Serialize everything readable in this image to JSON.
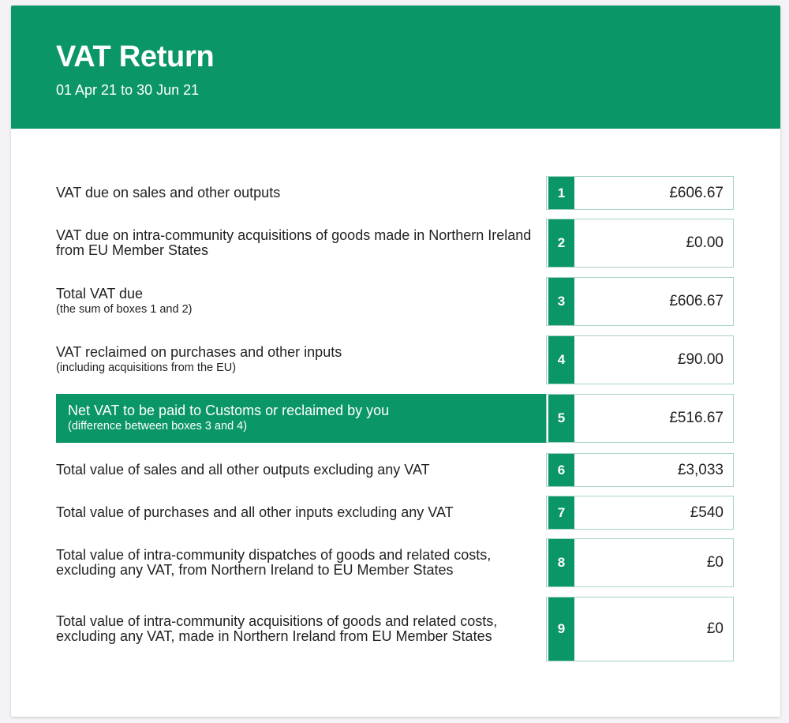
{
  "header": {
    "title": "VAT Return",
    "period": "01 Apr 21 to 30 Jun 21"
  },
  "colors": {
    "brand_green": "#0b9668",
    "box_border": "#a7d3c1"
  },
  "rows": [
    {
      "box": "1",
      "label": "VAT due on sales and other outputs",
      "sublabel": "",
      "value": "£606.67",
      "highlight": false
    },
    {
      "box": "2",
      "label": "VAT due on intra-community acquisitions of goods made in Northern Ireland from EU Member States",
      "sublabel": "",
      "value": "£0.00",
      "highlight": false
    },
    {
      "box": "3",
      "label": "Total VAT due",
      "sublabel": "(the sum of boxes 1 and 2)",
      "value": "£606.67",
      "highlight": false
    },
    {
      "box": "4",
      "label": "VAT reclaimed on purchases and other inputs",
      "sublabel": "(including acquisitions from the EU)",
      "value": "£90.00",
      "highlight": false
    },
    {
      "box": "5",
      "label": "Net VAT to be paid to Customs or reclaimed by you",
      "sublabel": "(difference between boxes 3 and 4)",
      "value": "£516.67",
      "highlight": true
    },
    {
      "box": "6",
      "label": "Total value of sales and all other outputs excluding any VAT",
      "sublabel": "",
      "value": "£3,033",
      "highlight": false
    },
    {
      "box": "7",
      "label": "Total value of purchases and all other inputs excluding any VAT",
      "sublabel": "",
      "value": "£540",
      "highlight": false
    },
    {
      "box": "8",
      "label": "Total value of intra-community dispatches of goods and related costs, excluding any VAT, from Northern Ireland to EU Member States",
      "sublabel": "",
      "value": "£0",
      "highlight": false
    },
    {
      "box": "9",
      "label": "Total value of intra-community acquisitions of goods and related costs, excluding any VAT, made in Northern Ireland from EU Member States",
      "sublabel": "",
      "value": "£0",
      "highlight": false
    }
  ]
}
